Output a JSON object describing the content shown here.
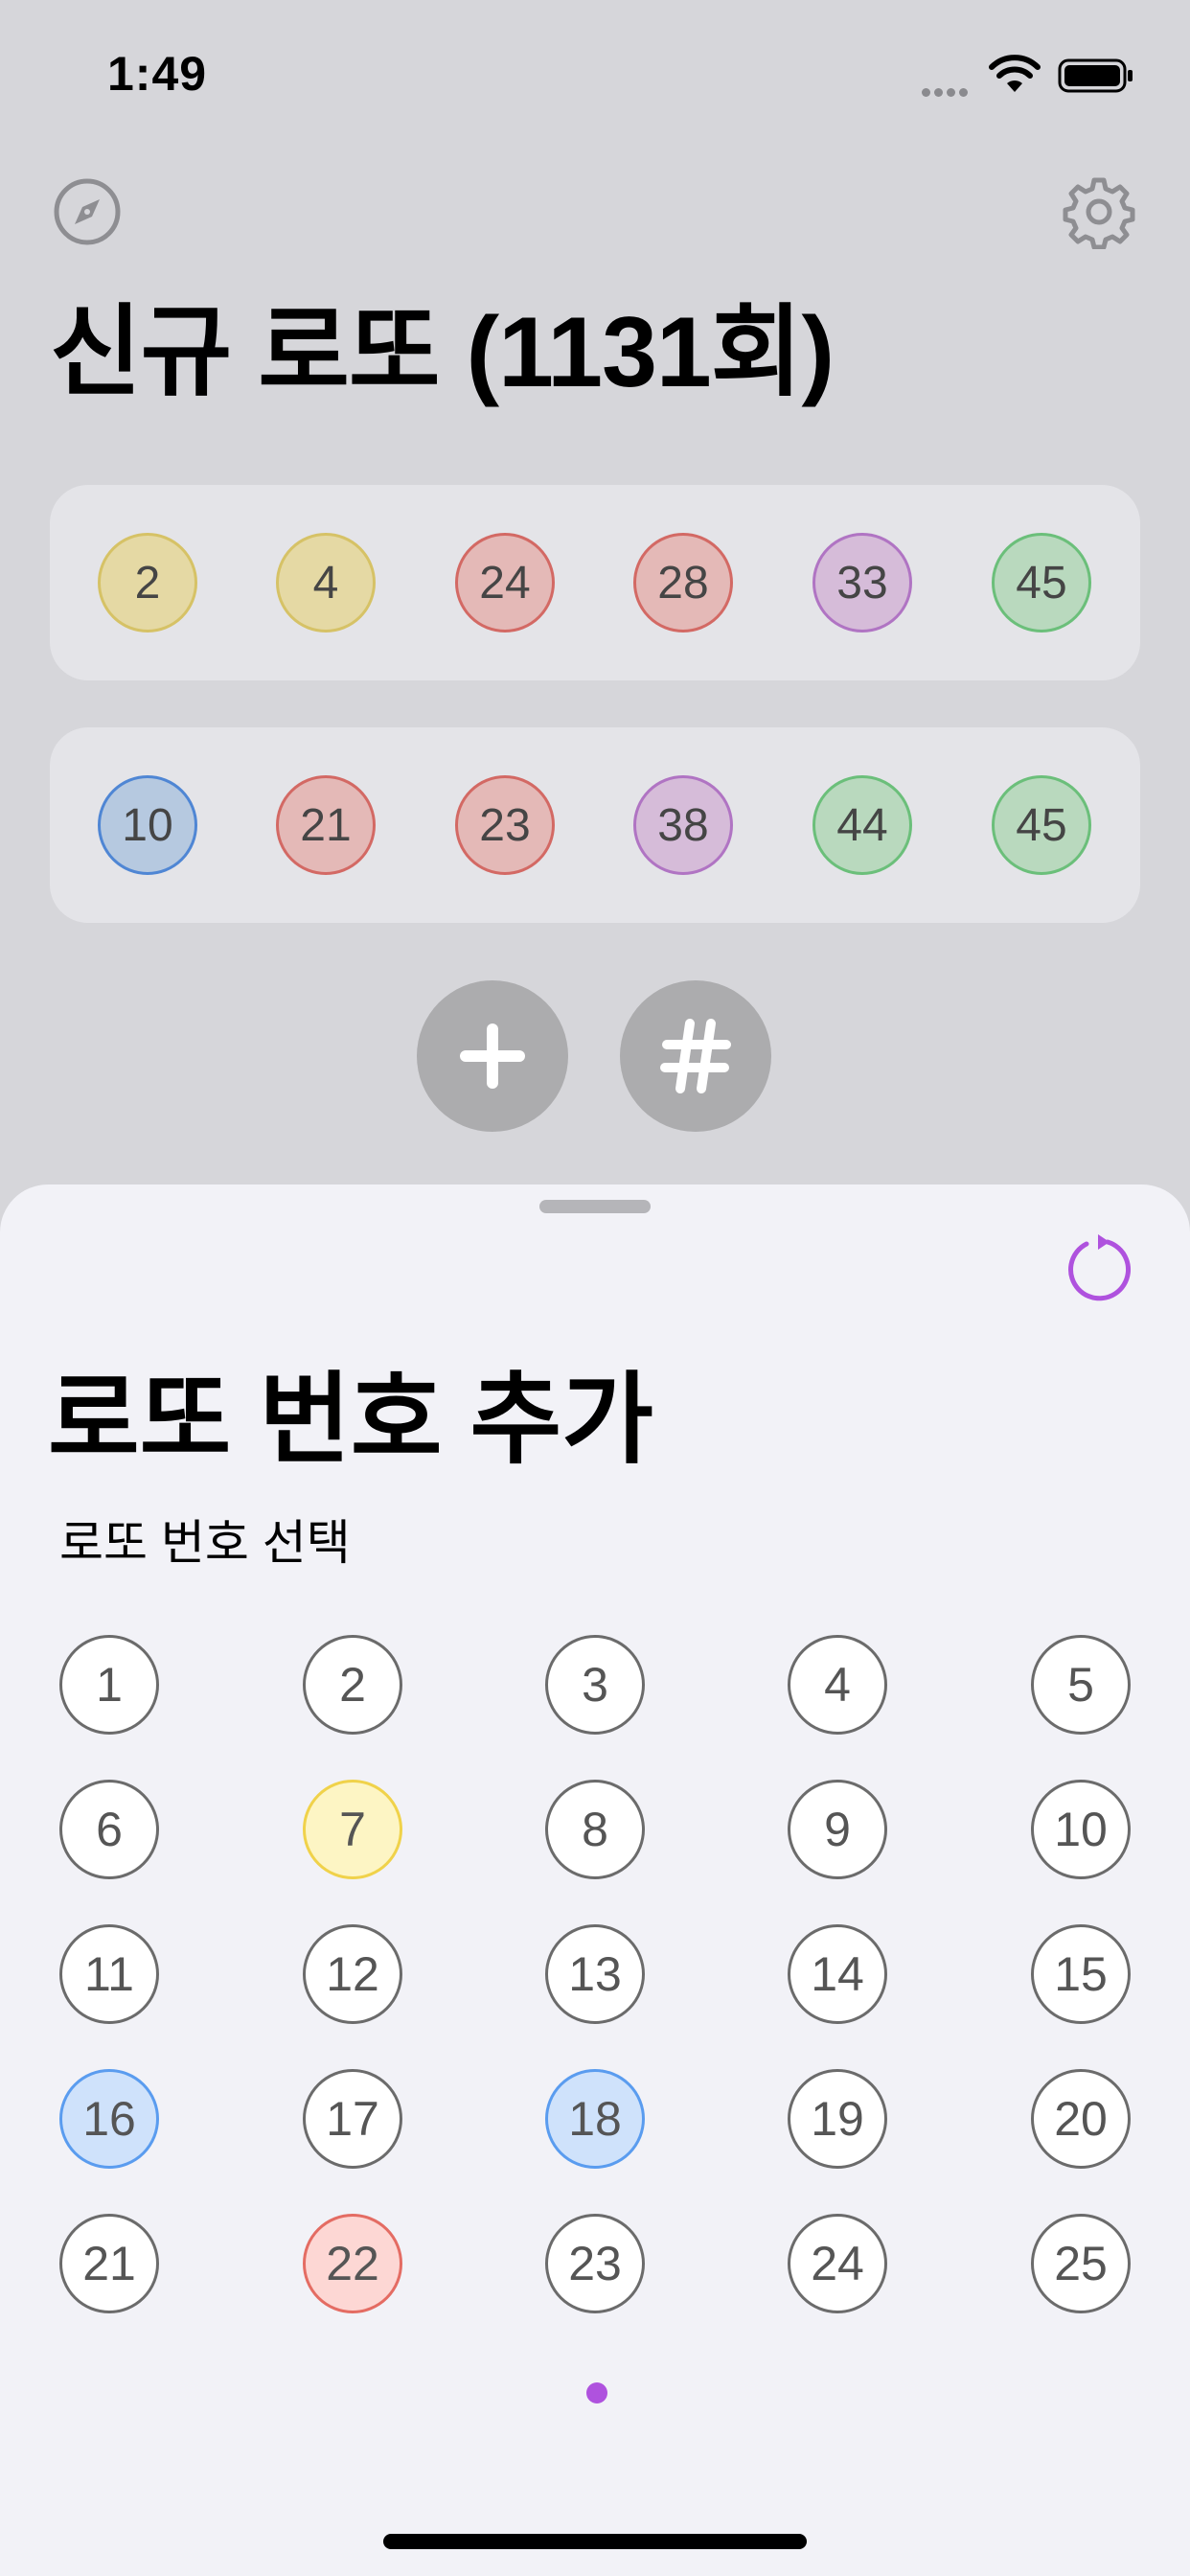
{
  "status_bar": {
    "time": "1:49"
  },
  "header": {
    "title": "신규 로또 (1131회)",
    "left_icon": "compass-icon",
    "right_icon": "gear-icon"
  },
  "tickets": [
    {
      "balls": [
        {
          "number": "2",
          "color": "yellow"
        },
        {
          "number": "4",
          "color": "yellow"
        },
        {
          "number": "24",
          "color": "red"
        },
        {
          "number": "28",
          "color": "red"
        },
        {
          "number": "33",
          "color": "purple"
        },
        {
          "number": "45",
          "color": "green"
        }
      ]
    },
    {
      "balls": [
        {
          "number": "10",
          "color": "blue"
        },
        {
          "number": "21",
          "color": "red"
        },
        {
          "number": "23",
          "color": "red"
        },
        {
          "number": "38",
          "color": "purple"
        },
        {
          "number": "44",
          "color": "green"
        },
        {
          "number": "45",
          "color": "green"
        }
      ]
    }
  ],
  "actions": {
    "add_icon": "plus-icon",
    "hash_icon": "hash-icon"
  },
  "sheet": {
    "title": "로또 번호 추가",
    "subtitle": "로또 번호 선택",
    "refresh_icon": "refresh-icon",
    "numbers": [
      {
        "n": "1",
        "state": "none"
      },
      {
        "n": "2",
        "state": "none"
      },
      {
        "n": "3",
        "state": "none"
      },
      {
        "n": "4",
        "state": "none"
      },
      {
        "n": "5",
        "state": "none"
      },
      {
        "n": "6",
        "state": "none"
      },
      {
        "n": "7",
        "state": "yellow"
      },
      {
        "n": "8",
        "state": "none"
      },
      {
        "n": "9",
        "state": "none"
      },
      {
        "n": "10",
        "state": "none"
      },
      {
        "n": "11",
        "state": "none"
      },
      {
        "n": "12",
        "state": "none"
      },
      {
        "n": "13",
        "state": "none"
      },
      {
        "n": "14",
        "state": "none"
      },
      {
        "n": "15",
        "state": "none"
      },
      {
        "n": "16",
        "state": "blue"
      },
      {
        "n": "17",
        "state": "none"
      },
      {
        "n": "18",
        "state": "blue"
      },
      {
        "n": "19",
        "state": "none"
      },
      {
        "n": "20",
        "state": "none"
      },
      {
        "n": "21",
        "state": "none"
      },
      {
        "n": "22",
        "state": "red"
      },
      {
        "n": "23",
        "state": "none"
      },
      {
        "n": "24",
        "state": "none"
      },
      {
        "n": "25",
        "state": "none"
      }
    ]
  },
  "colors": {
    "accent": "#af52de",
    "yellow": "#f0d24a",
    "blue": "#5a9cef",
    "red": "#e46c63",
    "green": "#6bbf7a",
    "purple": "#b074c3"
  }
}
